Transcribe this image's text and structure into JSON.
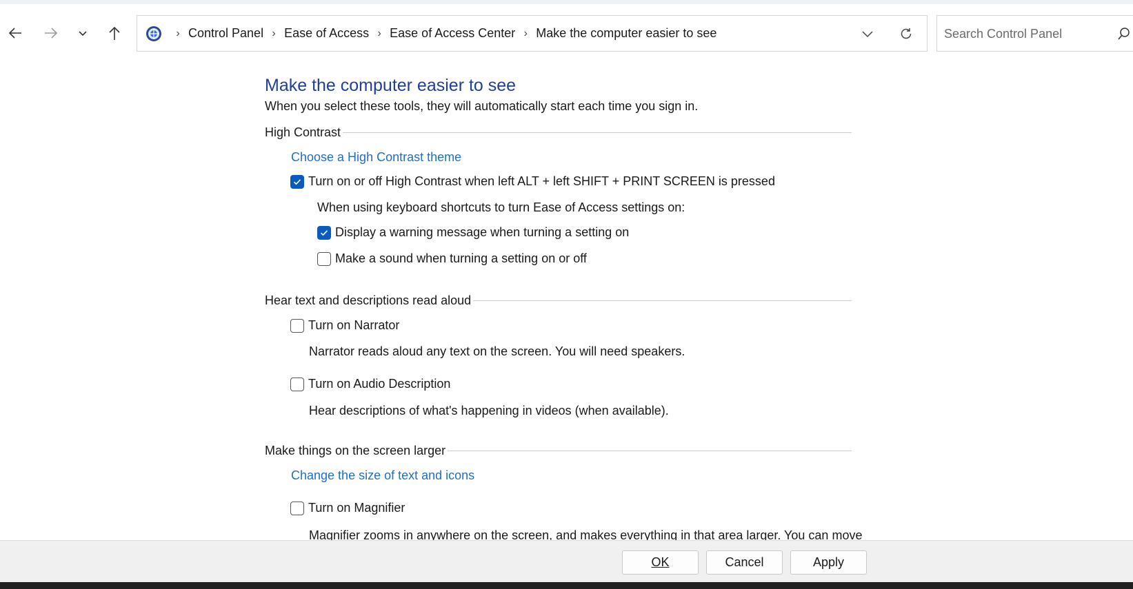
{
  "nav": {
    "back_icon": "arrow-left-icon",
    "forward_icon": "arrow-right-icon",
    "recent_icon": "chevron-down-icon",
    "up_icon": "arrow-up-icon"
  },
  "address": {
    "icon": "control-panel-icon",
    "breadcrumbs": [
      "Control Panel",
      "Ease of Access",
      "Ease of Access Center",
      "Make the computer easier to see"
    ],
    "separator": "›"
  },
  "search": {
    "placeholder": "Search Control Panel"
  },
  "page": {
    "title": "Make the computer easier to see",
    "subtitle": "When you select these tools, they will automatically start each time you sign in."
  },
  "sections": {
    "high_contrast": {
      "heading": "High Contrast",
      "link": "Choose a High Contrast theme",
      "toggle_label": "Turn on or off High Contrast when left ALT + left SHIFT + PRINT SCREEN is pressed",
      "toggle_checked": true,
      "shortcut_intro": "When using keyboard shortcuts to turn Ease of Access settings on:",
      "warning_label": "Display a warning message when turning a setting on",
      "warning_checked": true,
      "sound_label": "Make a sound when turning a setting on or off",
      "sound_checked": false
    },
    "read_aloud": {
      "heading": "Hear text and descriptions read aloud",
      "narrator_label": "Turn on Narrator",
      "narrator_checked": false,
      "narrator_desc": "Narrator reads aloud any text on the screen. You will need speakers.",
      "audio_desc_label": "Turn on Audio Description",
      "audio_desc_checked": false,
      "audio_desc_desc": "Hear descriptions of what's happening in videos (when available)."
    },
    "larger": {
      "heading": "Make things on the screen larger",
      "link": "Change the size of text and icons",
      "magnifier_label": "Turn on Magnifier",
      "magnifier_checked": false,
      "magnifier_desc": "Magnifier zooms in anywhere on the screen, and makes everything in that area larger. You can move"
    }
  },
  "buttons": {
    "ok": "OK",
    "cancel": "Cancel",
    "apply": "Apply"
  },
  "colors": {
    "title": "#1f3f9a",
    "link": "#1f6fc1",
    "checkbox_on": "#0a5bc0"
  }
}
